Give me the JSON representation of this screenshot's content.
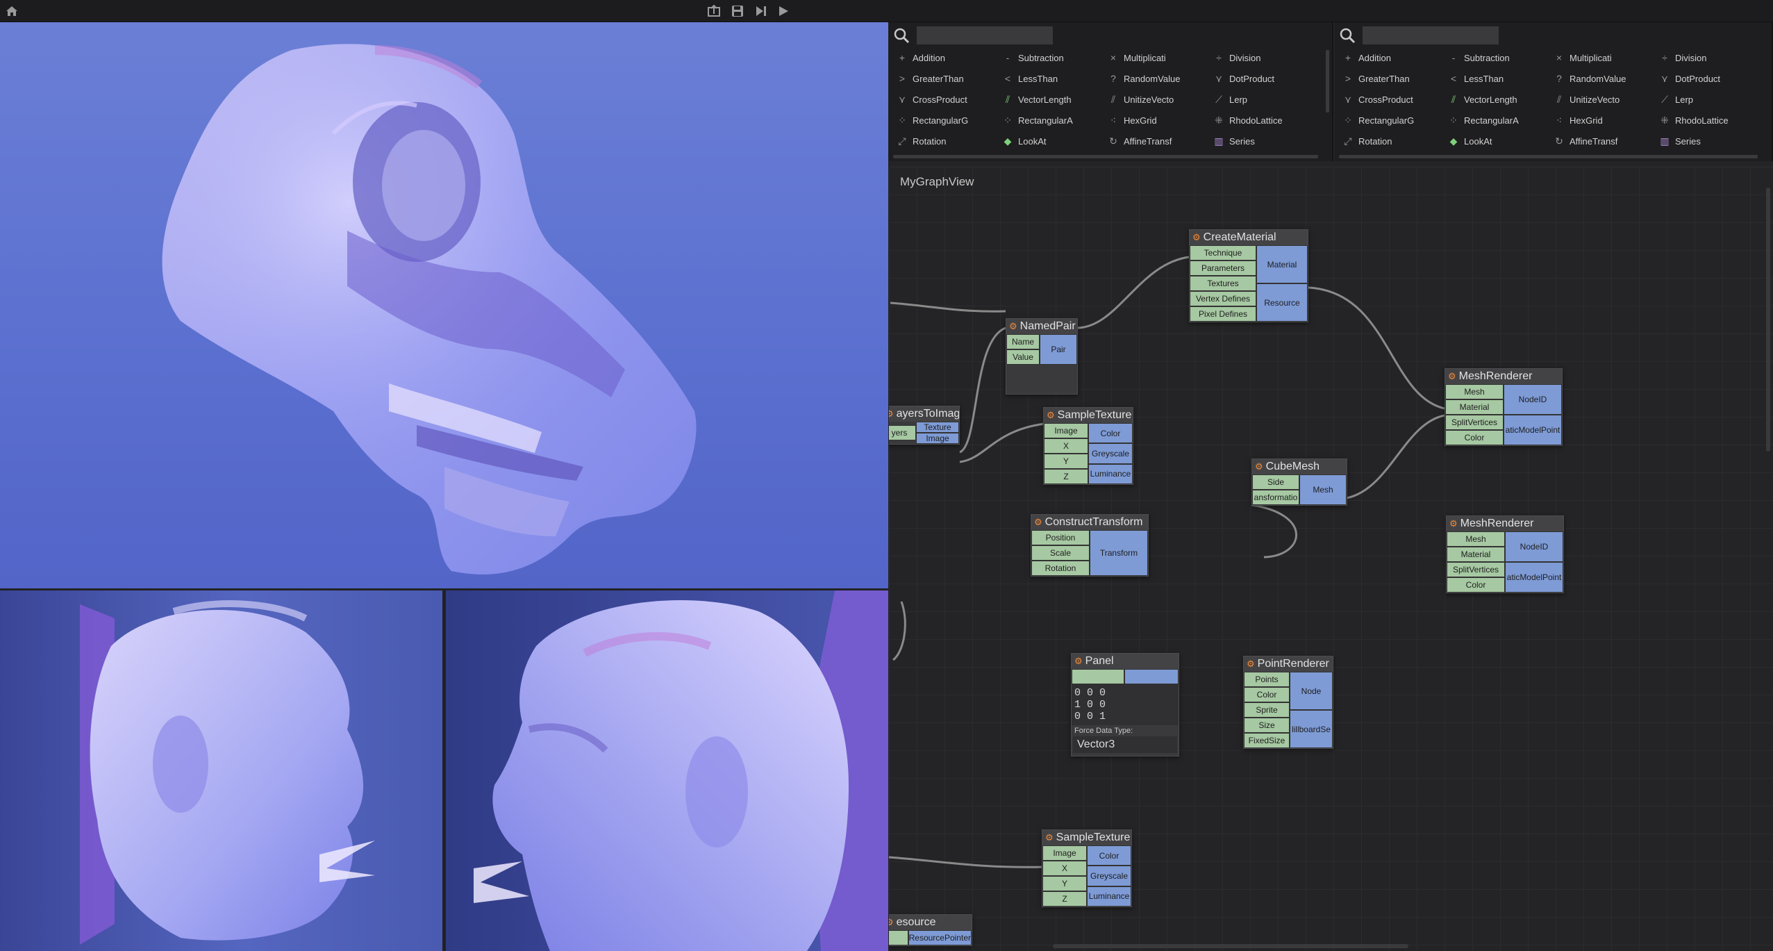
{
  "toolbar": {
    "icons": [
      "home-icon",
      "export-icon",
      "save-icon",
      "step-icon",
      "play-icon"
    ],
    "glyphs": {
      "home": "⌂",
      "export": "⇪",
      "save": "💾",
      "step": "⏭",
      "play": "▶"
    }
  },
  "viewports": {
    "main": {
      "subject": "skull-volume-render"
    },
    "left": {
      "subject": "head-volume-render"
    },
    "right": {
      "subject": "head-volume-render"
    }
  },
  "palettes": [
    {
      "search_value": "",
      "items": [
        {
          "label": "Addition",
          "icon": "+",
          "kind": "plain"
        },
        {
          "label": "Subtraction",
          "icon": "-",
          "kind": "plain"
        },
        {
          "label": "Multiplicati",
          "icon": "×",
          "kind": "plain"
        },
        {
          "label": "Division",
          "icon": "÷",
          "kind": "plain"
        },
        {
          "label": "GreaterThan",
          "icon": ">",
          "kind": "plain"
        },
        {
          "label": "LessThan",
          "icon": "<",
          "kind": "plain"
        },
        {
          "label": "RandomValue",
          "icon": "?",
          "kind": "plain"
        },
        {
          "label": "DotProduct",
          "icon": "⋎",
          "kind": "plain"
        },
        {
          "label": "CrossProduct",
          "icon": "⋎",
          "kind": "plain"
        },
        {
          "label": "VectorLength",
          "icon": "⫽",
          "kind": "g"
        },
        {
          "label": "UnitizeVecto",
          "icon": "⫽",
          "kind": "plain"
        },
        {
          "label": "Lerp",
          "icon": "⟋",
          "kind": "plain"
        },
        {
          "label": "RectangularG",
          "icon": "⁘",
          "kind": "plain"
        },
        {
          "label": "RectangularA",
          "icon": "⁘",
          "kind": "plain"
        },
        {
          "label": "HexGrid",
          "icon": "⁖",
          "kind": "plain"
        },
        {
          "label": "RhodoLattice",
          "icon": "⁜",
          "kind": "plain"
        },
        {
          "label": "Rotation",
          "icon": "⤢",
          "kind": "plain"
        },
        {
          "label": "LookAt",
          "icon": "◆",
          "kind": "g"
        },
        {
          "label": "AffineTransf",
          "icon": "↻",
          "kind": "plain"
        },
        {
          "label": "Series",
          "icon": "▥",
          "kind": "p"
        }
      ]
    },
    {
      "search_value": "",
      "items": [
        {
          "label": "Addition",
          "icon": "+",
          "kind": "plain"
        },
        {
          "label": "Subtraction",
          "icon": "-",
          "kind": "plain"
        },
        {
          "label": "Multiplicati",
          "icon": "×",
          "kind": "plain"
        },
        {
          "label": "Division",
          "icon": "÷",
          "kind": "plain"
        },
        {
          "label": "GreaterThan",
          "icon": ">",
          "kind": "plain"
        },
        {
          "label": "LessThan",
          "icon": "<",
          "kind": "plain"
        },
        {
          "label": "RandomValue",
          "icon": "?",
          "kind": "plain"
        },
        {
          "label": "DotProduct",
          "icon": "⋎",
          "kind": "plain"
        },
        {
          "label": "CrossProduct",
          "icon": "⋎",
          "kind": "plain"
        },
        {
          "label": "VectorLength",
          "icon": "⫽",
          "kind": "g"
        },
        {
          "label": "UnitizeVecto",
          "icon": "⫽",
          "kind": "plain"
        },
        {
          "label": "Lerp",
          "icon": "⟋",
          "kind": "plain"
        },
        {
          "label": "RectangularG",
          "icon": "⁘",
          "kind": "plain"
        },
        {
          "label": "RectangularA",
          "icon": "⁘",
          "kind": "plain"
        },
        {
          "label": "HexGrid",
          "icon": "⁖",
          "kind": "plain"
        },
        {
          "label": "RhodoLattice",
          "icon": "⁜",
          "kind": "plain"
        },
        {
          "label": "Rotation",
          "icon": "⤢",
          "kind": "plain"
        },
        {
          "label": "LookAt",
          "icon": "◆",
          "kind": "g"
        },
        {
          "label": "AffineTransf",
          "icon": "↻",
          "kind": "plain"
        },
        {
          "label": "Series",
          "icon": "▥",
          "kind": "p"
        }
      ]
    }
  ],
  "graph": {
    "title": "MyGraphView",
    "nodes": {
      "create_material": {
        "title": "CreateMaterial",
        "inputs": [
          "Technique",
          "Parameters",
          "Textures",
          "Vertex Defines",
          "Pixel Defines"
        ],
        "outputs": [
          "Material",
          "Resource"
        ]
      },
      "named_pair": {
        "title": "NamedPair",
        "inputs": [
          "Name",
          "Value"
        ],
        "outputs": [
          "Pair"
        ]
      },
      "mesh_renderer_1": {
        "title": "MeshRenderer",
        "inputs": [
          "Mesh",
          "Material",
          "SplitVertices",
          "Color"
        ],
        "outputs": [
          "NodeID",
          "aticModelPoint"
        ]
      },
      "layers_to_image": {
        "title": "ayersToImage",
        "inputs": [
          "yers"
        ],
        "outputs": [
          "Texture",
          "Image"
        ]
      },
      "sample_texture_1": {
        "title": "SampleTexture",
        "inputs": [
          "Image",
          "X",
          "Y",
          "Z"
        ],
        "outputs": [
          "Color",
          "Greyscale",
          "Luminance"
        ]
      },
      "cube_mesh": {
        "title": "CubeMesh",
        "inputs": [
          "Side",
          "ansformatio"
        ],
        "outputs": [
          "Mesh"
        ]
      },
      "construct_transform": {
        "title": "ConstructTransform",
        "inputs": [
          "Position",
          "Scale",
          "Rotation"
        ],
        "outputs": [
          "Transform"
        ]
      },
      "mesh_renderer_2": {
        "title": "MeshRenderer",
        "inputs": [
          "Mesh",
          "Material",
          "SplitVertices",
          "Color"
        ],
        "outputs": [
          "NodeID",
          "aticModelPoint"
        ]
      },
      "panel": {
        "title": "Panel",
        "lines": "0 0 0\n1 0 0\n0 0 1",
        "force_label": "Force Data Type:",
        "force_value": "Vector3"
      },
      "point_renderer": {
        "title": "PointRenderer",
        "inputs": [
          "Points",
          "Color",
          "Sprite",
          "Size",
          "FixedSize"
        ],
        "outputs": [
          "Node",
          "lillboardSe"
        ]
      },
      "sample_texture_2": {
        "title": "SampleTexture",
        "inputs": [
          "Image",
          "X",
          "Y",
          "Z"
        ],
        "outputs": [
          "Color",
          "Greyscale",
          "Luminance"
        ]
      },
      "resource_node": {
        "title": "esource",
        "inputs": [
          ""
        ],
        "outputs": [
          "ResourcePointer"
        ]
      }
    }
  }
}
